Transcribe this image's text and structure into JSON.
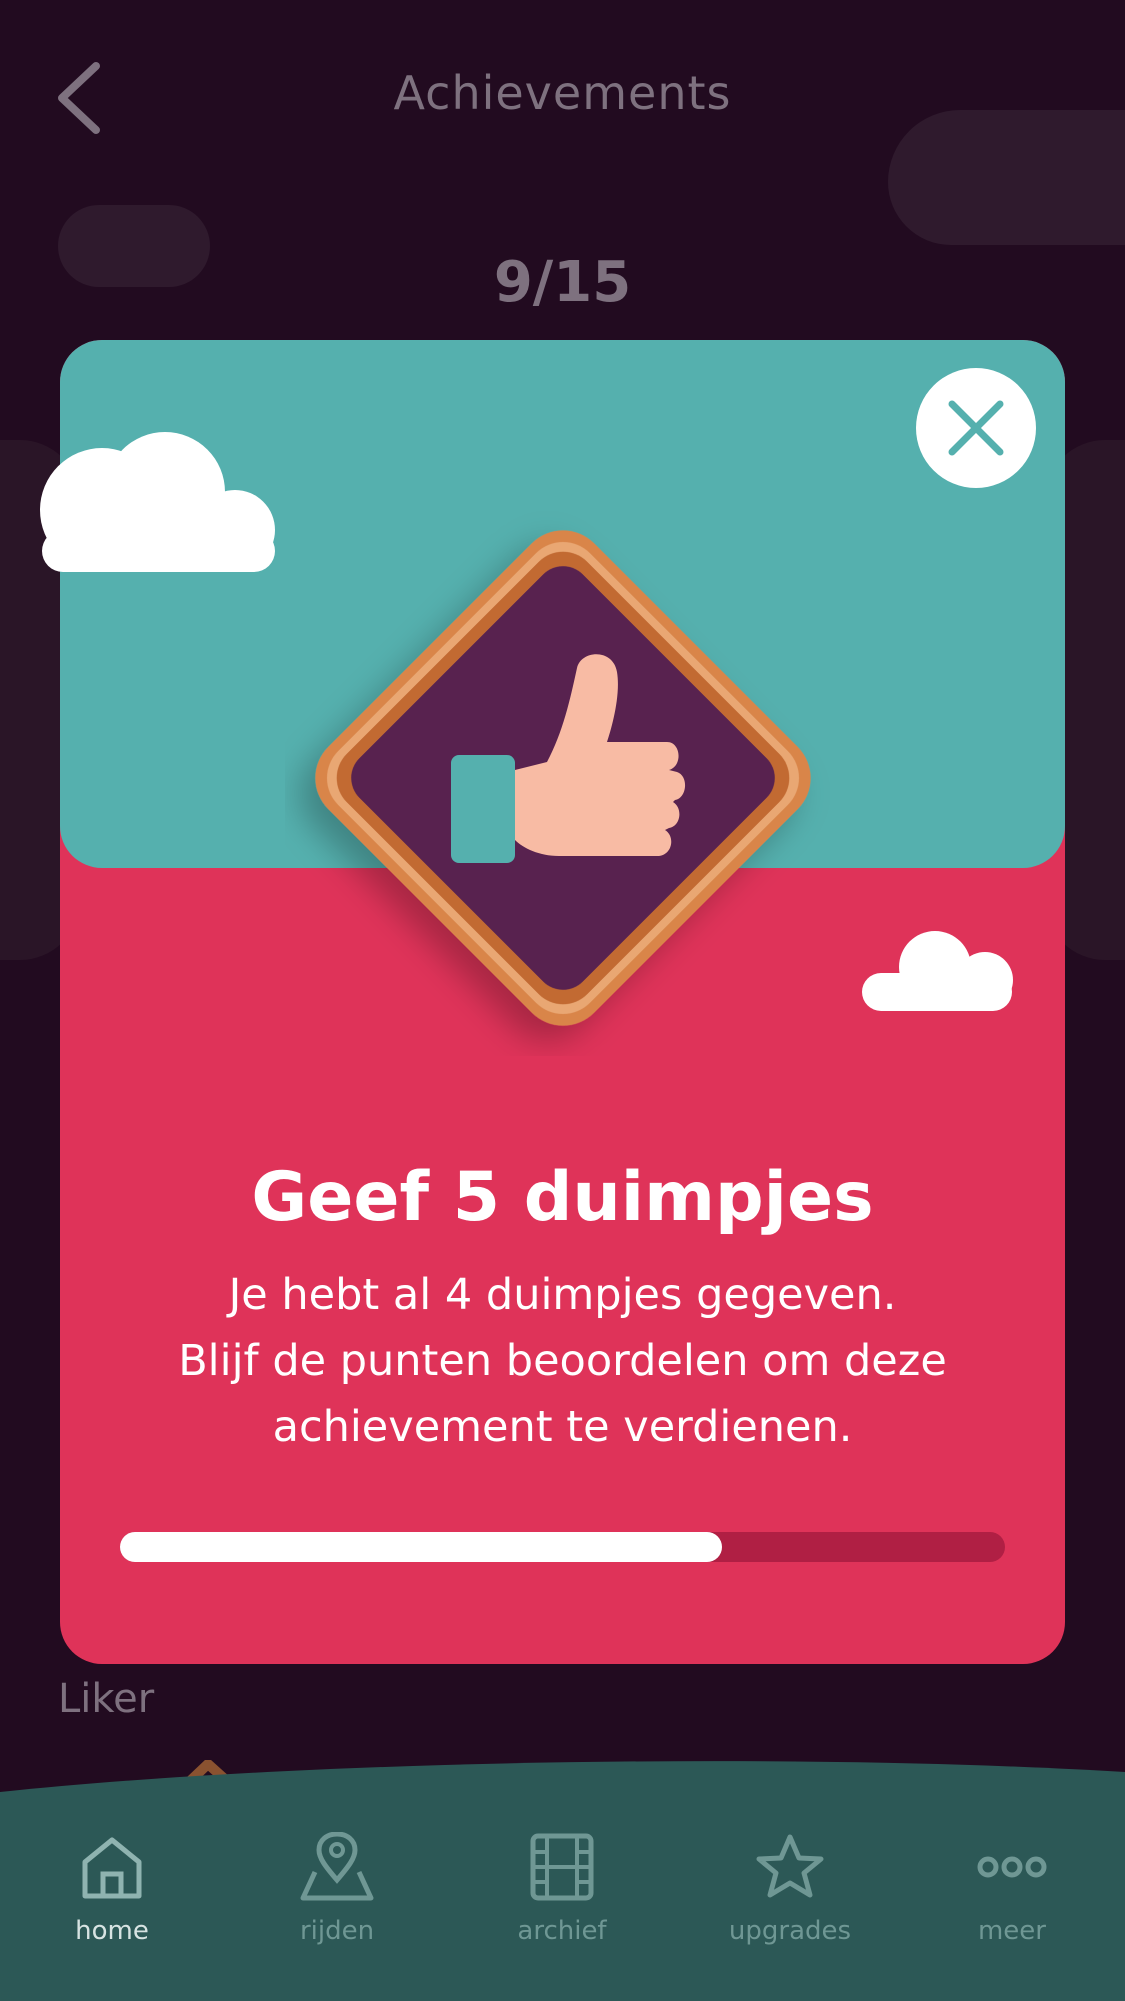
{
  "header": {
    "title": "Achievements",
    "back_icon": "chevron-left-icon"
  },
  "counter": "9/15",
  "modal": {
    "title": "Geef 5 duimpjes",
    "description_lines": [
      "Je hebt al 4 duimpjes gegeven.",
      "Blijf de punten beoordelen om deze",
      "achievement te verdienen."
    ],
    "progress_fraction": 0.68,
    "badge_icon": "thumbs-up-icon",
    "close_icon": "close-icon",
    "colors": {
      "top": "#55b0ae",
      "bottom": "#df3359",
      "badge": "#59244f",
      "frame": "#d9854a"
    }
  },
  "section_label": "Liker",
  "nav": {
    "items": [
      {
        "label": "home",
        "icon": "home-icon",
        "active": true
      },
      {
        "label": "rijden",
        "icon": "map-pin-icon",
        "active": false
      },
      {
        "label": "archief",
        "icon": "film-icon",
        "active": false
      },
      {
        "label": "upgrades",
        "icon": "star-icon",
        "active": false
      },
      {
        "label": "meer",
        "icon": "more-icon",
        "active": false
      }
    ]
  }
}
